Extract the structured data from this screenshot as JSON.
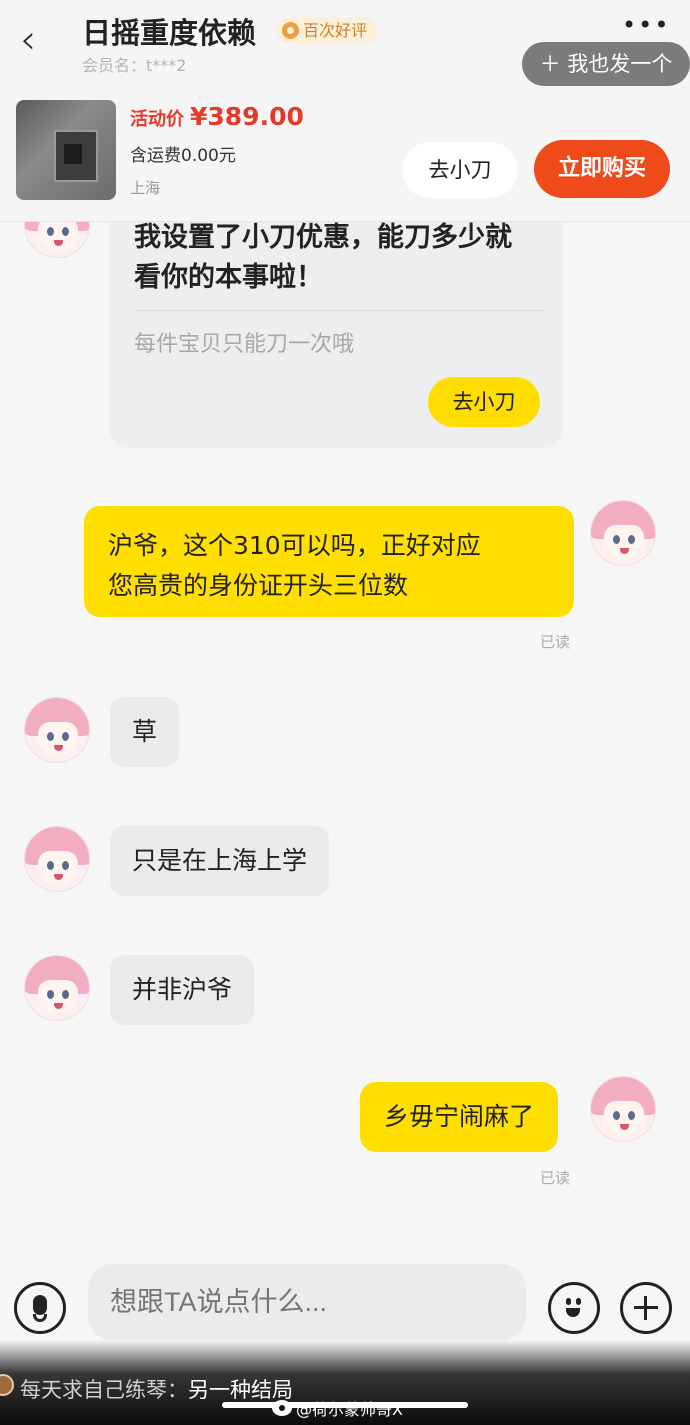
{
  "header": {
    "title": "日摇重度依赖",
    "badge": "百次好评",
    "member": "会员名：t***2",
    "more": "•••",
    "post_button": "＋ 我也发一个"
  },
  "product": {
    "price_label": "活动价",
    "price": "¥389.00",
    "shipping": "含运费0.00元",
    "location": "上海",
    "bargain_button": "去小刀",
    "buy_button": "立即购买"
  },
  "card": {
    "text": "我设置了小刀优惠，能刀多少就看你的本事啦！",
    "subtext": "每件宝贝只能刀一次哦",
    "button": "去小刀"
  },
  "messages": [
    {
      "side": "out",
      "text_line1": "沪爷，这个310可以吗，正好对应",
      "text_line2": "您高贵的身份证开头三位数",
      "status": "已读"
    },
    {
      "side": "in",
      "text": "草"
    },
    {
      "side": "in",
      "text": "只是在上海上学"
    },
    {
      "side": "in",
      "text": "并非沪爷"
    },
    {
      "side": "out",
      "text": "乡毋宁闹麻了",
      "status": "已读"
    }
  ],
  "input": {
    "placeholder": "想跟TA说点什么..."
  },
  "overlay": {
    "comment_user": "每天求自己练琴：",
    "comment_text": "另一种结局",
    "watermark": "@荷尔蒙帅哥X"
  },
  "icons": {
    "back": "chevron-left-icon",
    "more": "more-dots-icon",
    "mic": "microphone-icon",
    "emoji": "emoji-icon",
    "plus": "plus-icon"
  },
  "colors": {
    "accent_yellow": "#ffdf00",
    "buy_orange": "#ee4a1a",
    "price_red": "#e33a2a"
  }
}
